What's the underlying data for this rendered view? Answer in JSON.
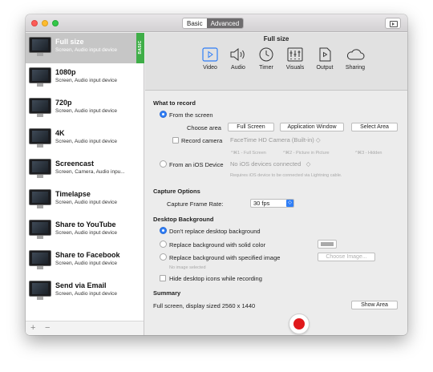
{
  "titlebar": {
    "segments": [
      "Basic",
      "Advanced"
    ],
    "active_segment": "Advanced"
  },
  "sidebar": {
    "items": [
      {
        "name": "Full size",
        "desc": "Screen, Audio input device",
        "selected": true,
        "tag": "BASIC"
      },
      {
        "name": "1080p",
        "desc": "Screen, Audio input device"
      },
      {
        "name": "720p",
        "desc": "Screen, Audio input device"
      },
      {
        "name": "4K",
        "desc": "Screen, Audio input device"
      },
      {
        "name": "Screencast",
        "desc": "Screen, Camera, Audio inpu..."
      },
      {
        "name": "Timelapse",
        "desc": "Screen, Audio input device"
      },
      {
        "name": "Share to YouTube",
        "desc": "Screen, Audio input device"
      },
      {
        "name": "Share to Facebook",
        "desc": "Screen, Audio input device"
      },
      {
        "name": "Send via Email",
        "desc": "Screen, Audio input device"
      }
    ],
    "add_label": "+",
    "remove_label": "−"
  },
  "header": {
    "title": "Full size",
    "tabs": [
      {
        "label": "Video",
        "icon": "video-icon",
        "active": true
      },
      {
        "label": "Audio",
        "icon": "speaker-icon"
      },
      {
        "label": "Timer",
        "icon": "clock-icon"
      },
      {
        "label": "Visuals",
        "icon": "visuals-icon"
      },
      {
        "label": "Output",
        "icon": "document-play-icon"
      },
      {
        "label": "Sharing",
        "icon": "cloud-icon"
      }
    ],
    "accent": "#2f7ef6"
  },
  "record": {
    "heading": "What to record",
    "from_screen": "From the screen",
    "choose_area": "Choose area",
    "full_screen": "Full Screen",
    "app_window": "Application Window",
    "select_area": "Select Area",
    "record_camera": "Record camera",
    "camera_value": "FaceTime HD Camera (Built-in)",
    "shortcut1": "^⌘1 - Full Screen",
    "shortcut2": "^⌘2 - Picture in Picture",
    "shortcut3": "^⌘3 - Hidden",
    "from_ios": "From an iOS Device",
    "ios_value": "No iOS devices connected",
    "ios_hint": "Requires iOS device to be connected via Lightning cable."
  },
  "capture": {
    "heading": "Capture Options",
    "frame_rate_label": "Capture Frame Rate:",
    "frame_rate": "30 fps"
  },
  "desktop": {
    "heading": "Desktop Background",
    "opt1": "Don't replace desktop background",
    "opt2": "Replace background with solid color",
    "opt3": "Replace background with specified image",
    "choose_image": "Choose Image...",
    "no_image": "No image selected",
    "hide_icons": "Hide desktop icons while recording"
  },
  "summary": {
    "heading": "Summary",
    "text": "Full screen, display sized 2560 x 1440",
    "show_area": "Show Area"
  },
  "colors": {
    "basic_tag": "#3fae48",
    "record": "#e0181b"
  }
}
